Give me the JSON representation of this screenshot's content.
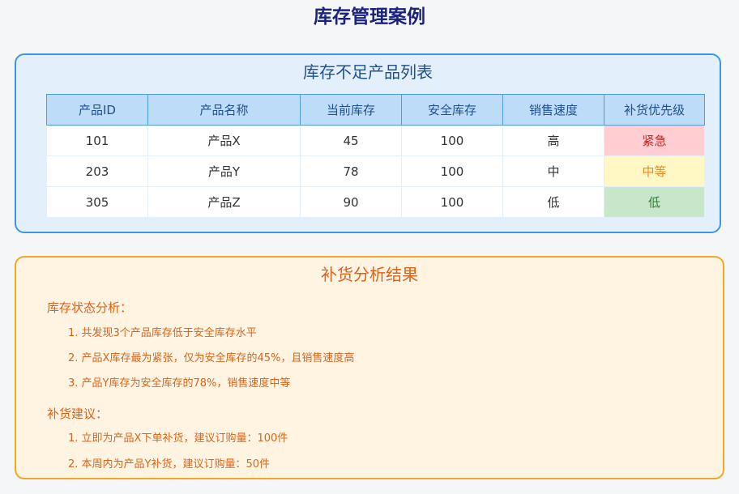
{
  "page": {
    "title": "库存管理案例"
  },
  "inventory_panel": {
    "title": "库存不足产品列表",
    "columns": [
      "产品ID",
      "产品名称",
      "当前库存",
      "安全库存",
      "销售速度",
      "补货优先级"
    ],
    "rows": [
      [
        "101",
        "产品X",
        "45",
        "100",
        "高",
        "紧急"
      ],
      [
        "203",
        "产品Y",
        "78",
        "100",
        "中",
        "中等"
      ],
      [
        "305",
        "产品Z",
        "90",
        "100",
        "低",
        "低"
      ]
    ],
    "priority_colors": {
      "urgent_bg": "#ffcdd2",
      "medium_bg": "#fff8c4",
      "low_bg": "#c8e6c9"
    }
  },
  "analysis_panel": {
    "title": "补货分析结果",
    "status_heading": "库存状态分析：",
    "status_items": [
      "1. 共发现3个产品库存低于安全库存水平",
      "2. 产品X库存最为紧张，仅为安全库存的45%，且销售速度高",
      "3. 产品Y库存为安全库存的78%，销售速度中等"
    ],
    "advice_heading": "补货建议：",
    "advice_items": [
      "1. 立即为产品X下单补货，建议订购量：100件",
      "2. 本周内为产品Y补货，建议订购量：50件"
    ]
  }
}
